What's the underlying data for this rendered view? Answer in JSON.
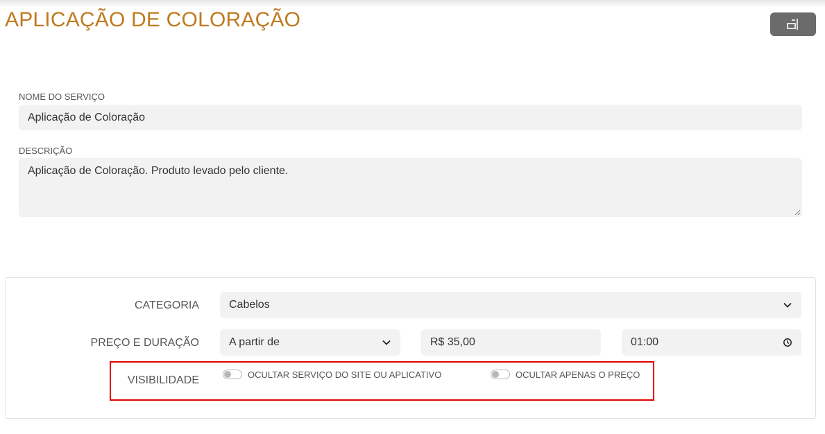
{
  "page": {
    "title": "APLICAÇÃO DE COLORAÇÃO"
  },
  "header": {
    "sidebar_toggle_icon": "sidebar-panel-icon"
  },
  "form": {
    "name_label": "NOME DO SERVIÇO",
    "name_value": "Aplicação de Coloração",
    "description_label": "DESCRIÇÃO",
    "description_value": "Aplicação de Coloração. Produto levado pelo cliente."
  },
  "details": {
    "category_label": "CATEGORIA",
    "category_value": "Cabelos",
    "price_duration_label": "PREÇO E DURAÇÃO",
    "price_type_value": "A partir de",
    "price_value": "R$ 35,00",
    "duration_value": "01:00",
    "visibility_label": "VISIBILIDADE",
    "hide_service_label": "OCULTAR SERVIÇO DO SITE OU APLICATIVO",
    "hide_service_on": false,
    "hide_price_label": "OCULTAR APENAS O PREÇO",
    "hide_price_on": false
  },
  "colors": {
    "title": "#c07a1f",
    "highlight": "#e00000",
    "field_bg": "#f2f2f2"
  }
}
